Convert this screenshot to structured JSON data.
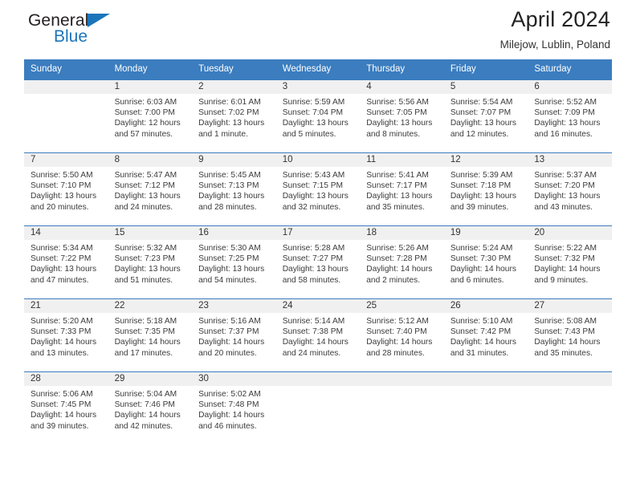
{
  "brand": {
    "word_one": "General",
    "word_two": "Blue",
    "triangle_icon": "triangle-icon"
  },
  "header": {
    "title": "April 2024",
    "subtitle": "Milejow, Lublin, Poland"
  },
  "colors": {
    "header_blue": "#3b7dbf",
    "band_gray": "#f0f0f0",
    "brand_blue": "#1b75bb",
    "text": "#333333"
  },
  "weekday_headers": [
    "Sunday",
    "Monday",
    "Tuesday",
    "Wednesday",
    "Thursday",
    "Friday",
    "Saturday"
  ],
  "weeks": [
    [
      {
        "day": "",
        "sunrise": "",
        "sunset": "",
        "daylight": "",
        "daylight2": ""
      },
      {
        "day": "1",
        "sunrise": "Sunrise: 6:03 AM",
        "sunset": "Sunset: 7:00 PM",
        "daylight": "Daylight: 12 hours",
        "daylight2": "and 57 minutes."
      },
      {
        "day": "2",
        "sunrise": "Sunrise: 6:01 AM",
        "sunset": "Sunset: 7:02 PM",
        "daylight": "Daylight: 13 hours",
        "daylight2": "and 1 minute."
      },
      {
        "day": "3",
        "sunrise": "Sunrise: 5:59 AM",
        "sunset": "Sunset: 7:04 PM",
        "daylight": "Daylight: 13 hours",
        "daylight2": "and 5 minutes."
      },
      {
        "day": "4",
        "sunrise": "Sunrise: 5:56 AM",
        "sunset": "Sunset: 7:05 PM",
        "daylight": "Daylight: 13 hours",
        "daylight2": "and 8 minutes."
      },
      {
        "day": "5",
        "sunrise": "Sunrise: 5:54 AM",
        "sunset": "Sunset: 7:07 PM",
        "daylight": "Daylight: 13 hours",
        "daylight2": "and 12 minutes."
      },
      {
        "day": "6",
        "sunrise": "Sunrise: 5:52 AM",
        "sunset": "Sunset: 7:09 PM",
        "daylight": "Daylight: 13 hours",
        "daylight2": "and 16 minutes."
      }
    ],
    [
      {
        "day": "7",
        "sunrise": "Sunrise: 5:50 AM",
        "sunset": "Sunset: 7:10 PM",
        "daylight": "Daylight: 13 hours",
        "daylight2": "and 20 minutes."
      },
      {
        "day": "8",
        "sunrise": "Sunrise: 5:47 AM",
        "sunset": "Sunset: 7:12 PM",
        "daylight": "Daylight: 13 hours",
        "daylight2": "and 24 minutes."
      },
      {
        "day": "9",
        "sunrise": "Sunrise: 5:45 AM",
        "sunset": "Sunset: 7:13 PM",
        "daylight": "Daylight: 13 hours",
        "daylight2": "and 28 minutes."
      },
      {
        "day": "10",
        "sunrise": "Sunrise: 5:43 AM",
        "sunset": "Sunset: 7:15 PM",
        "daylight": "Daylight: 13 hours",
        "daylight2": "and 32 minutes."
      },
      {
        "day": "11",
        "sunrise": "Sunrise: 5:41 AM",
        "sunset": "Sunset: 7:17 PM",
        "daylight": "Daylight: 13 hours",
        "daylight2": "and 35 minutes."
      },
      {
        "day": "12",
        "sunrise": "Sunrise: 5:39 AM",
        "sunset": "Sunset: 7:18 PM",
        "daylight": "Daylight: 13 hours",
        "daylight2": "and 39 minutes."
      },
      {
        "day": "13",
        "sunrise": "Sunrise: 5:37 AM",
        "sunset": "Sunset: 7:20 PM",
        "daylight": "Daylight: 13 hours",
        "daylight2": "and 43 minutes."
      }
    ],
    [
      {
        "day": "14",
        "sunrise": "Sunrise: 5:34 AM",
        "sunset": "Sunset: 7:22 PM",
        "daylight": "Daylight: 13 hours",
        "daylight2": "and 47 minutes."
      },
      {
        "day": "15",
        "sunrise": "Sunrise: 5:32 AM",
        "sunset": "Sunset: 7:23 PM",
        "daylight": "Daylight: 13 hours",
        "daylight2": "and 51 minutes."
      },
      {
        "day": "16",
        "sunrise": "Sunrise: 5:30 AM",
        "sunset": "Sunset: 7:25 PM",
        "daylight": "Daylight: 13 hours",
        "daylight2": "and 54 minutes."
      },
      {
        "day": "17",
        "sunrise": "Sunrise: 5:28 AM",
        "sunset": "Sunset: 7:27 PM",
        "daylight": "Daylight: 13 hours",
        "daylight2": "and 58 minutes."
      },
      {
        "day": "18",
        "sunrise": "Sunrise: 5:26 AM",
        "sunset": "Sunset: 7:28 PM",
        "daylight": "Daylight: 14 hours",
        "daylight2": "and 2 minutes."
      },
      {
        "day": "19",
        "sunrise": "Sunrise: 5:24 AM",
        "sunset": "Sunset: 7:30 PM",
        "daylight": "Daylight: 14 hours",
        "daylight2": "and 6 minutes."
      },
      {
        "day": "20",
        "sunrise": "Sunrise: 5:22 AM",
        "sunset": "Sunset: 7:32 PM",
        "daylight": "Daylight: 14 hours",
        "daylight2": "and 9 minutes."
      }
    ],
    [
      {
        "day": "21",
        "sunrise": "Sunrise: 5:20 AM",
        "sunset": "Sunset: 7:33 PM",
        "daylight": "Daylight: 14 hours",
        "daylight2": "and 13 minutes."
      },
      {
        "day": "22",
        "sunrise": "Sunrise: 5:18 AM",
        "sunset": "Sunset: 7:35 PM",
        "daylight": "Daylight: 14 hours",
        "daylight2": "and 17 minutes."
      },
      {
        "day": "23",
        "sunrise": "Sunrise: 5:16 AM",
        "sunset": "Sunset: 7:37 PM",
        "daylight": "Daylight: 14 hours",
        "daylight2": "and 20 minutes."
      },
      {
        "day": "24",
        "sunrise": "Sunrise: 5:14 AM",
        "sunset": "Sunset: 7:38 PM",
        "daylight": "Daylight: 14 hours",
        "daylight2": "and 24 minutes."
      },
      {
        "day": "25",
        "sunrise": "Sunrise: 5:12 AM",
        "sunset": "Sunset: 7:40 PM",
        "daylight": "Daylight: 14 hours",
        "daylight2": "and 28 minutes."
      },
      {
        "day": "26",
        "sunrise": "Sunrise: 5:10 AM",
        "sunset": "Sunset: 7:42 PM",
        "daylight": "Daylight: 14 hours",
        "daylight2": "and 31 minutes."
      },
      {
        "day": "27",
        "sunrise": "Sunrise: 5:08 AM",
        "sunset": "Sunset: 7:43 PM",
        "daylight": "Daylight: 14 hours",
        "daylight2": "and 35 minutes."
      }
    ],
    [
      {
        "day": "28",
        "sunrise": "Sunrise: 5:06 AM",
        "sunset": "Sunset: 7:45 PM",
        "daylight": "Daylight: 14 hours",
        "daylight2": "and 39 minutes."
      },
      {
        "day": "29",
        "sunrise": "Sunrise: 5:04 AM",
        "sunset": "Sunset: 7:46 PM",
        "daylight": "Daylight: 14 hours",
        "daylight2": "and 42 minutes."
      },
      {
        "day": "30",
        "sunrise": "Sunrise: 5:02 AM",
        "sunset": "Sunset: 7:48 PM",
        "daylight": "Daylight: 14 hours",
        "daylight2": "and 46 minutes."
      },
      {
        "day": "",
        "sunrise": "",
        "sunset": "",
        "daylight": "",
        "daylight2": ""
      },
      {
        "day": "",
        "sunrise": "",
        "sunset": "",
        "daylight": "",
        "daylight2": ""
      },
      {
        "day": "",
        "sunrise": "",
        "sunset": "",
        "daylight": "",
        "daylight2": ""
      },
      {
        "day": "",
        "sunrise": "",
        "sunset": "",
        "daylight": "",
        "daylight2": ""
      }
    ]
  ]
}
